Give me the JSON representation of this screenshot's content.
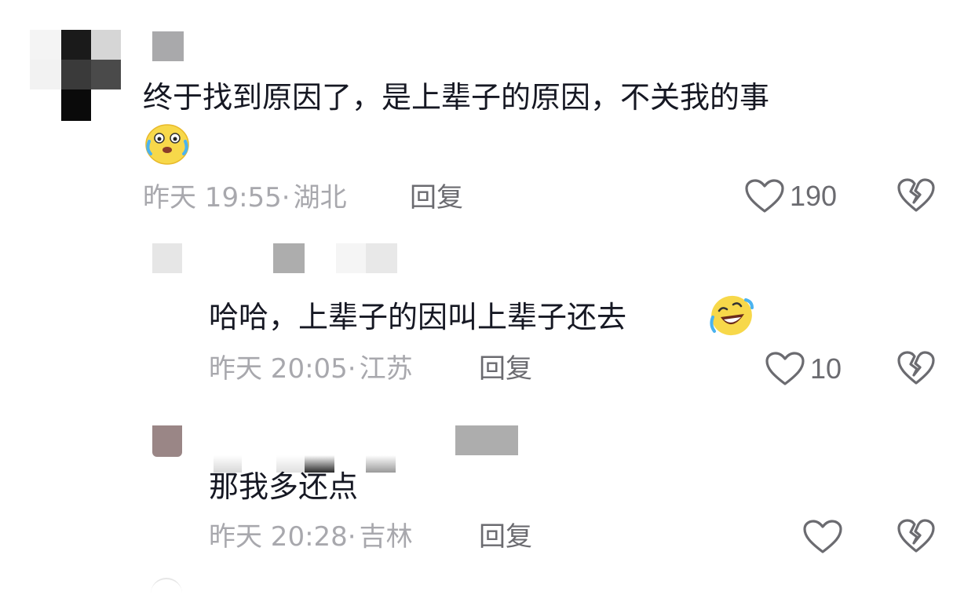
{
  "comments": [
    {
      "text": "终于找到原因了，是上辈子的原因，不关我的事",
      "emoji": "crying-laughing-emoji",
      "time": "昨天 19:55",
      "location": "湖北",
      "reply_label": "回复",
      "likes": "190"
    },
    {
      "text": "哈哈，上辈子的因叫上辈子还去",
      "emoji": "rofl-emoji",
      "time": "昨天 20:05",
      "location": "江苏",
      "reply_label": "回复",
      "likes": "10"
    },
    {
      "text": "那我多还点",
      "time": "昨天 20:28",
      "location": "吉林",
      "reply_label": "回复",
      "likes": ""
    }
  ],
  "separator": "·",
  "icons": {
    "like": "heart-outline-icon",
    "dislike": "broken-heart-icon"
  },
  "colors": {
    "text": "#161823",
    "meta": "#a8a8ad",
    "action": "#6b6b70"
  }
}
